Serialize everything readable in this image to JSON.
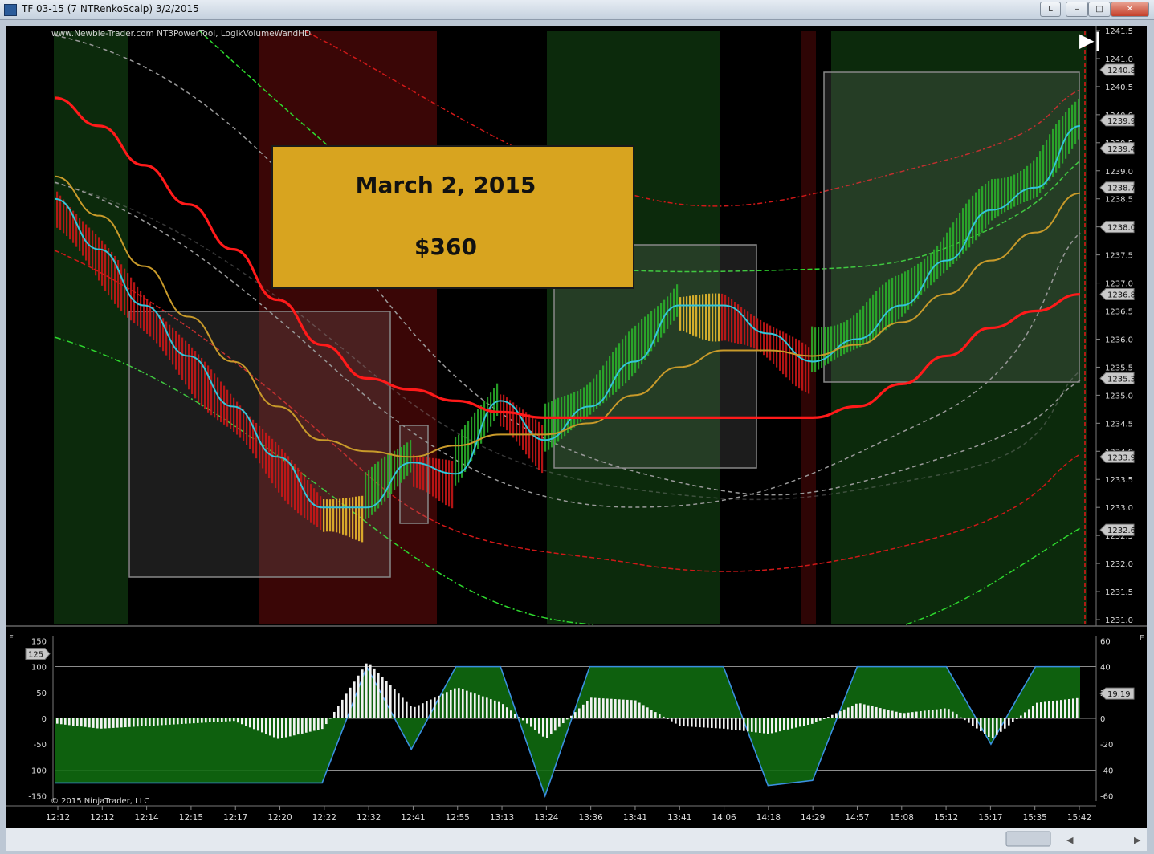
{
  "window": {
    "title": "TF 03-15 (7 NTRenkoScalp)  3/2/2015",
    "buttons": {
      "l_label": "L",
      "minimize": "–",
      "maximize": "□",
      "close": "✕"
    }
  },
  "chart": {
    "watermark_top": "www.Newbie-Trader.com NT3PowerTool, LogikVolumeWandHD",
    "copyright": "© 2015 NinjaTrader, LLC",
    "panel_labels": [
      "F",
      "F"
    ],
    "annotation": {
      "line1": "March 2, 2015",
      "line2": "$360"
    },
    "colors": {
      "bullish": "#2bb52b",
      "bearish": "#d01818",
      "neutral": "#f2c12e",
      "signal": "#34c4d8",
      "annotation_bg": "#d8a41f"
    }
  },
  "chart_data": [
    {
      "type": "line",
      "panel": "price",
      "categories": [
        "12:12",
        "12:12",
        "12:14",
        "12:15",
        "12:17",
        "12:20",
        "12:22",
        "12:32",
        "12:41",
        "12:55",
        "13:13",
        "13:24",
        "13:36",
        "13:41",
        "13:41",
        "14:06",
        "14:18",
        "14:29",
        "14:57",
        "15:08",
        "15:12",
        "15:17",
        "15:35",
        "15:42"
      ],
      "ylim": [
        1231.0,
        1241.5
      ],
      "y_ticks": [
        1231.0,
        1231.5,
        1232.0,
        1232.5,
        1233.0,
        1233.5,
        1234.0,
        1234.5,
        1235.0,
        1235.5,
        1236.0,
        1236.5,
        1237.0,
        1237.5,
        1238.0,
        1238.5,
        1239.0,
        1239.5,
        1240.0,
        1240.5,
        1241.0,
        1241.5
      ],
      "y_tick_labels": [
        "1231.0",
        "1231.5",
        "1232.0",
        "1232.5",
        "1233.0",
        "1233.5",
        "1234.0",
        "1234.5",
        "1235.0",
        "1235.5",
        "1236.0",
        "1236.5",
        "1237.0",
        "1237.5",
        "1238.0",
        "1238.5",
        "1239.0",
        "1239.5",
        "1240.0",
        "1240.5",
        "1241.0",
        "1241.5"
      ],
      "price_flags": [
        {
          "label": "1240.8",
          "value": 1240.8
        },
        {
          "label": "1239.9",
          "value": 1239.9
        },
        {
          "label": "1239.4",
          "value": 1239.4
        },
        {
          "label": "1238.7",
          "value": 1238.7
        },
        {
          "label": "1238.0",
          "value": 1238.0
        },
        {
          "label": "1236.8",
          "value": 1236.8
        },
        {
          "label": "1235.3",
          "value": 1235.3
        },
        {
          "label": "1233.9",
          "value": 1233.9
        },
        {
          "label": "1232.6",
          "value": 1232.6
        }
      ],
      "series": [
        {
          "values": [
            1238.5,
            1237.6,
            1236.6,
            1235.7,
            1234.8,
            1233.9,
            1233.0,
            1233.0,
            1233.8,
            1233.6,
            1234.9,
            1234.2,
            1234.8,
            1235.6,
            1236.6,
            1236.6,
            1236.1,
            1235.6,
            1236.0,
            1236.6,
            1237.4,
            1238.3,
            1238.7,
            1239.8
          ],
          "color": "#34c4d8"
        },
        {
          "values": [
            1238.9,
            1238.2,
            1237.3,
            1236.4,
            1235.6,
            1234.8,
            1234.2,
            1234.0,
            1233.9,
            1234.1,
            1234.3,
            1234.3,
            1234.5,
            1235.0,
            1235.5,
            1235.8,
            1235.8,
            1235.7,
            1235.9,
            1236.3,
            1236.8,
            1237.4,
            1237.9,
            1238.6
          ],
          "color": "#c89a2a"
        },
        {
          "values": [
            1240.3,
            1239.8,
            1239.1,
            1238.4,
            1237.6,
            1236.7,
            1235.9,
            1235.3,
            1235.1,
            1234.9,
            1234.7,
            1234.6,
            1234.6,
            1234.6,
            1234.6,
            1234.6,
            1234.6,
            1234.6,
            1234.8,
            1235.2,
            1235.7,
            1236.2,
            1236.5,
            1236.8
          ],
          "color": "#ff1a1a"
        }
      ]
    },
    {
      "type": "bar",
      "panel": "oscillator",
      "categories": [
        "12:12",
        "12:12",
        "12:14",
        "12:15",
        "12:17",
        "12:20",
        "12:22",
        "12:32",
        "12:41",
        "12:55",
        "13:13",
        "13:24",
        "13:36",
        "13:41",
        "13:41",
        "14:06",
        "14:18",
        "14:29",
        "14:57",
        "15:08",
        "15:12",
        "15:17",
        "15:35",
        "15:42"
      ],
      "ylim": [
        -160,
        160
      ],
      "y_ticks_left": [
        150,
        100,
        50,
        0,
        -50,
        -100,
        -150
      ],
      "y_tick_labels_left": [
        "150",
        "100",
        "50",
        "0",
        "-50",
        "-100",
        "-150"
      ],
      "y_ticks_right": [
        60,
        40,
        20,
        0,
        -20,
        -40,
        -60
      ],
      "y_tick_labels_right": [
        "60",
        "40",
        "20",
        "0",
        "-20",
        "-40",
        "-60"
      ],
      "flag_left": {
        "label": "125",
        "value": 125
      },
      "flag_right": {
        "label": "19.19",
        "value": 19.19
      },
      "series": [
        {
          "name": "histogram",
          "values": [
            -10,
            -20,
            -15,
            -10,
            -5,
            -40,
            -20,
            110,
            20,
            60,
            30,
            -40,
            40,
            35,
            -15,
            -20,
            -30,
            -10,
            30,
            10,
            20,
            -40,
            30,
            40
          ]
        },
        {
          "name": "area",
          "values": [
            -125,
            -125,
            -125,
            -125,
            -125,
            -125,
            -125,
            100,
            -60,
            100,
            100,
            -150,
            100,
            100,
            100,
            100,
            -130,
            -120,
            100,
            100,
            100,
            -50,
            100,
            100
          ]
        }
      ]
    }
  ]
}
